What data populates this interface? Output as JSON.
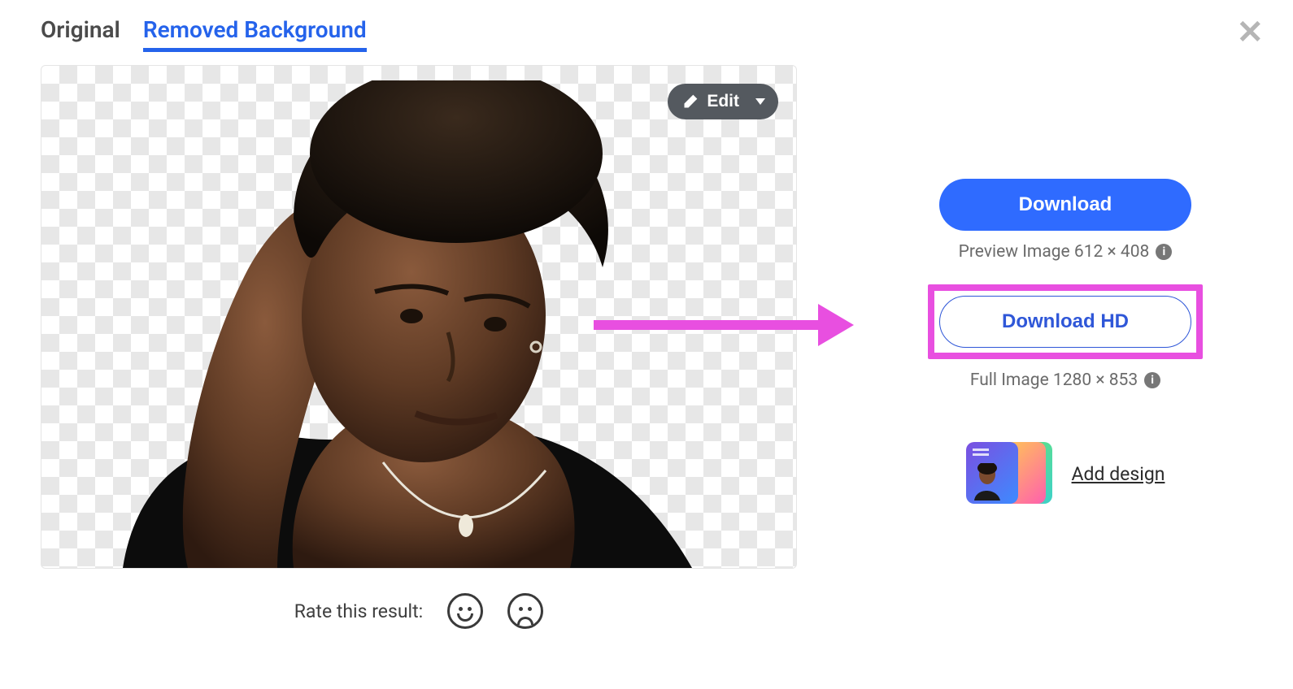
{
  "tabs": {
    "original": "Original",
    "removed": "Removed Background"
  },
  "edit_button": {
    "label": "Edit"
  },
  "rate": {
    "label": "Rate this result:"
  },
  "download": {
    "primary_label": "Download",
    "preview_info": "Preview Image 612 × 408",
    "hd_label": "Download HD",
    "full_info": "Full Image 1280 × 853"
  },
  "add_design": {
    "label": "Add design"
  }
}
